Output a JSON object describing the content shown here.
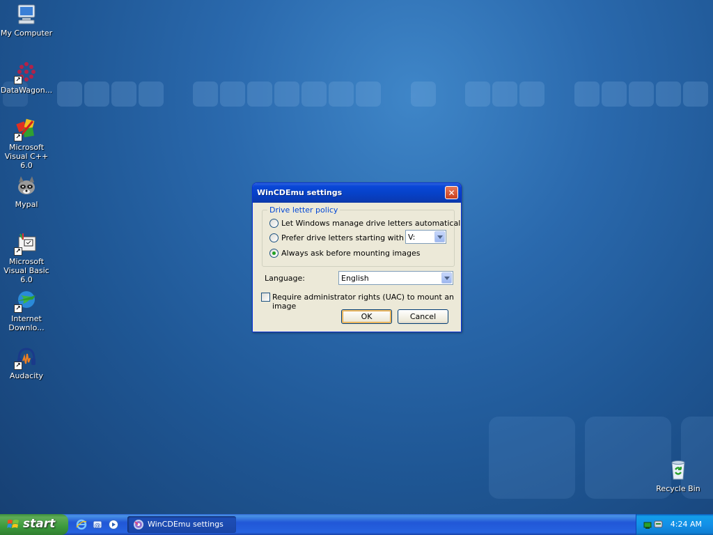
{
  "desktop": {
    "icons": [
      {
        "label": "My Computer",
        "icon": "computer-icon"
      },
      {
        "label": "DataWagon...",
        "icon": "datawagon-icon",
        "shortcut": true
      },
      {
        "label": "Microsoft Visual C++ 6.0",
        "icon": "visual-cpp-icon",
        "shortcut": true
      },
      {
        "label": "Mypal",
        "icon": "raccoon-icon",
        "shortcut": false
      },
      {
        "label": "Microsoft Visual Basic 6.0",
        "icon": "visual-basic-icon",
        "shortcut": true
      },
      {
        "label": "Internet Downlo...",
        "icon": "globe-download-icon",
        "shortcut": true
      },
      {
        "label": "Audacity",
        "icon": "headphones-icon",
        "shortcut": true
      }
    ],
    "recycle_bin": {
      "label": "Recycle Bin",
      "icon": "recycle-bin-icon"
    }
  },
  "dialog": {
    "title": "WinCDEmu settings",
    "close_icon": "close-icon",
    "drive_group": {
      "legend": "Drive letter policy",
      "options": [
        {
          "label": "Let Windows manage drive letters automatically",
          "checked": false
        },
        {
          "label": "Prefer drive letters starting with",
          "checked": false
        },
        {
          "label": "Always ask before mounting images",
          "checked": true
        }
      ],
      "drive_letter_value": "V:"
    },
    "language_label": "Language:",
    "language_value": "English",
    "uac_checkbox_label": "Require administrator rights (UAC) to mount an image",
    "uac_checked": false,
    "ok_label": "OK",
    "cancel_label": "Cancel"
  },
  "taskbar": {
    "start_label": "start",
    "quick_launch": [
      "ie-icon",
      "outlook-icon",
      "media-player-icon"
    ],
    "active_task": {
      "label": "WinCDEmu settings",
      "icon": "wincdemu-icon"
    },
    "tray": {
      "icons": [
        "network-icon",
        "safely-remove-icon"
      ],
      "clock": "4:24 AM"
    }
  },
  "colors": {
    "desktop_blue": "#2a69ad",
    "titlebar_blue": "#0642c9",
    "taskbar_blue": "#2157d7",
    "start_green": "#3c9a3c",
    "dialog_face": "#ece9d8",
    "groupbox_legend": "#0046d5",
    "close_red": "#c8401e"
  }
}
